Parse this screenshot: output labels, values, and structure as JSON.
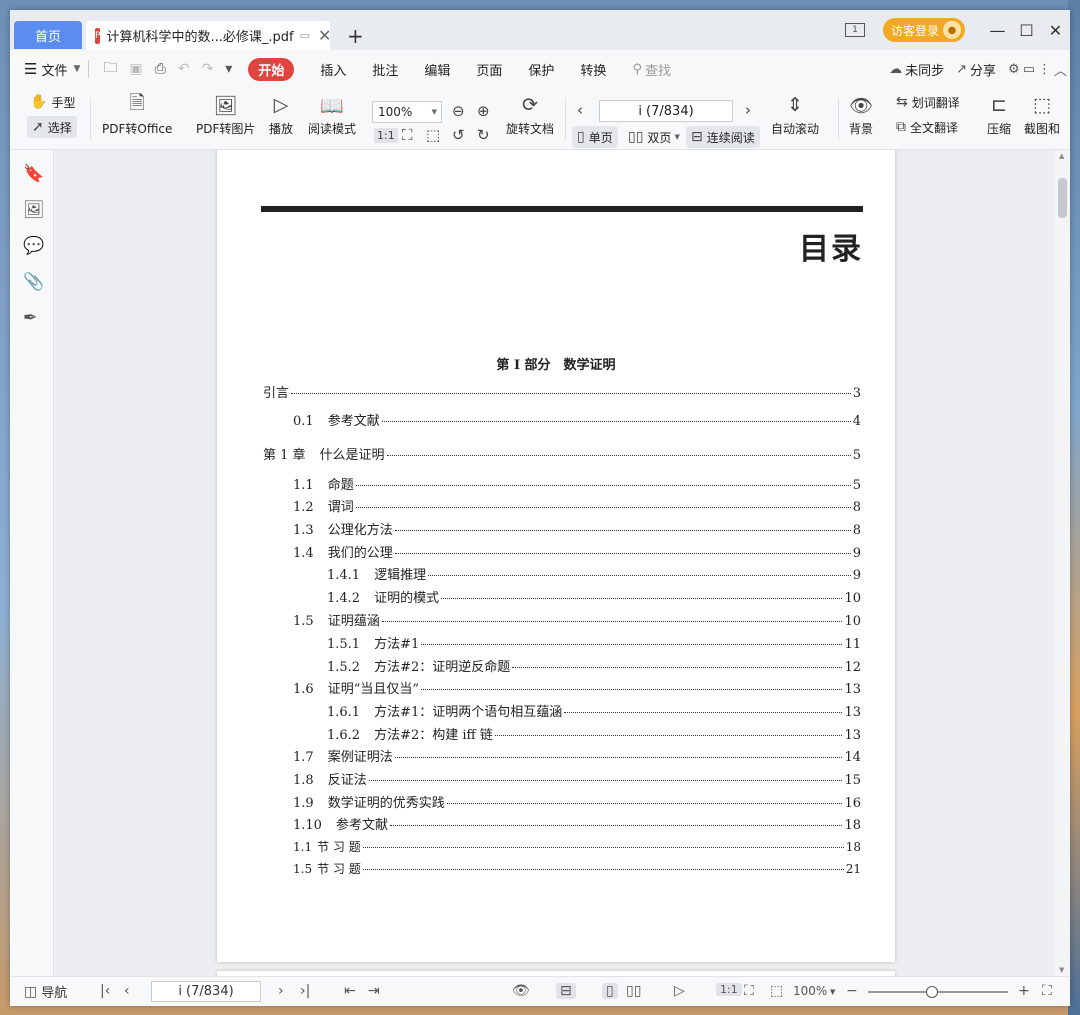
{
  "titlebar": {
    "home_tab": "首页",
    "doc_tab_title": "计算机科学中的数...必修课_.pdf",
    "new_tab": "+",
    "login_label": "访客登录",
    "min": "—",
    "max": "☐",
    "close": "✕"
  },
  "menubar": {
    "file_label": "文件",
    "start_label": "开始",
    "items": [
      "插入",
      "批注",
      "编辑",
      "页面",
      "保护",
      "转换"
    ],
    "search_placeholder": "查找",
    "sync_label": "未同步",
    "share_label": "分享"
  },
  "ribbon": {
    "hand_label": "手型",
    "select_label": "选择",
    "pdf_to_office": "PDF转Office",
    "pdf_to_image": "PDF转图片",
    "play": "播放",
    "read_mode": "阅读模式",
    "zoom_value": "100%",
    "rotate_doc": "旋转文档",
    "page_indicator": "i (7/834)",
    "single_page": "单页",
    "double_page": "双页",
    "continuous": "连续阅读",
    "auto_scroll": "自动滚动",
    "background": "背景",
    "word_translate": "划词翻译",
    "full_translate": "全文翻译",
    "compress": "压缩",
    "screenshot": "截图和"
  },
  "document": {
    "toc_title": "目录",
    "part_title": "第 I 部分　数学证明",
    "toc": [
      {
        "level": 0,
        "num": "",
        "text": "引言",
        "page": "3"
      },
      {
        "level": 1,
        "num": "0.1",
        "text": "参考文献",
        "page": "4"
      },
      {
        "level": 0,
        "num": "第 1 章",
        "text": "什么是证明",
        "page": "5"
      },
      {
        "level": 1,
        "num": "1.1",
        "text": "命题",
        "page": "5"
      },
      {
        "level": 1,
        "num": "1.2",
        "text": "谓词",
        "page": "8"
      },
      {
        "level": 1,
        "num": "1.3",
        "text": "公理化方法",
        "page": "8"
      },
      {
        "level": 1,
        "num": "1.4",
        "text": "我们的公理",
        "page": "9"
      },
      {
        "level": 2,
        "num": "1.4.1",
        "text": "逻辑推理",
        "page": "9"
      },
      {
        "level": 2,
        "num": "1.4.2",
        "text": "证明的模式",
        "page": "10"
      },
      {
        "level": 1,
        "num": "1.5",
        "text": "证明蕴涵",
        "page": "10"
      },
      {
        "level": 2,
        "num": "1.5.1",
        "text": "方法#1",
        "page": "11"
      },
      {
        "level": 2,
        "num": "1.5.2",
        "text": "方法#2：证明逆反命题",
        "page": "12"
      },
      {
        "level": 1,
        "num": "1.6",
        "text": "证明“当且仅当”",
        "page": "13"
      },
      {
        "level": 2,
        "num": "1.6.1",
        "text": "方法#1：证明两个语句相互蕴涵",
        "page": "13"
      },
      {
        "level": 2,
        "num": "1.6.2",
        "text": "方法#2：构建 iff 链",
        "page": "13"
      },
      {
        "level": 1,
        "num": "1.7",
        "text": "案例证明法",
        "page": "14"
      },
      {
        "level": 1,
        "num": "1.8",
        "text": "反证法",
        "page": "15"
      },
      {
        "level": 1,
        "num": "1.9",
        "text": "数学证明的优秀实践",
        "page": "16"
      },
      {
        "level": 1,
        "num": "1.10",
        "text": "参考文献",
        "page": "18"
      },
      {
        "level": 1,
        "num": "1.1",
        "text": "节 习 题",
        "page": "18"
      },
      {
        "level": 1,
        "num": "1.5",
        "text": "节 习 题",
        "page": "21"
      }
    ]
  },
  "statusbar": {
    "nav_label": "导航",
    "page_indicator": "i (7/834)",
    "zoom_value": "100%",
    "zoom_slider_percent": 100
  }
}
